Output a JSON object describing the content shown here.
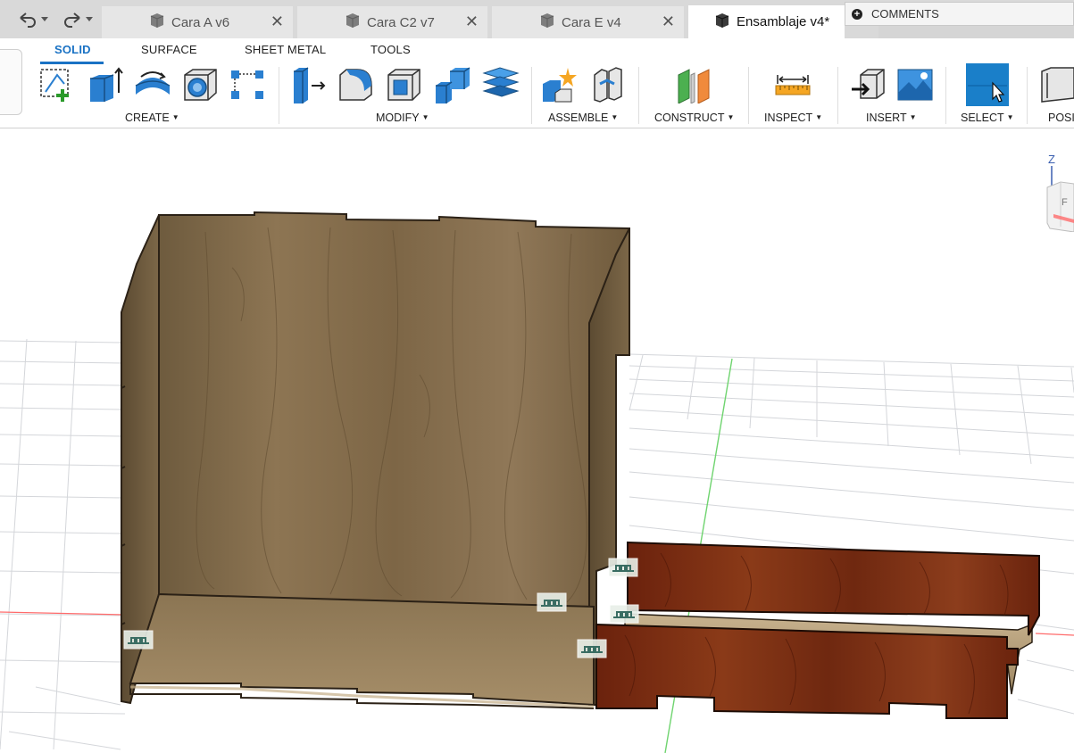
{
  "tabs": [
    {
      "label": "Cara A v6",
      "active": false
    },
    {
      "label": "Cara C2 v7",
      "active": false
    },
    {
      "label": "Cara E v4",
      "active": false
    },
    {
      "label": "Ensamblaje v4*",
      "active": true
    }
  ],
  "close_glyph": "✕",
  "comments_label": "COMMENTS",
  "ribbon_tabs": [
    "SOLID",
    "SURFACE",
    "SHEET METAL",
    "TOOLS"
  ],
  "groups": {
    "create": "CREATE",
    "modify": "MODIFY",
    "assemble": "ASSEMBLE",
    "construct": "CONSTRUCT",
    "inspect": "INSPECT",
    "insert": "INSERT",
    "select": "SELECT",
    "position": "POSI"
  },
  "viewcube": {
    "axis_label": "Z",
    "face_label": "F"
  },
  "icons": {
    "undo": "undo-icon",
    "redo": "redo-icon",
    "design": "design-document-icon",
    "comments": "add-comment-icon"
  },
  "colors": {
    "accent": "#1a72c4",
    "tab_strip": "#d9d9d9",
    "inactive_tab": "#e6e6e6",
    "wood_light": "#8a7250",
    "wood_dark": "#7a2e14"
  }
}
